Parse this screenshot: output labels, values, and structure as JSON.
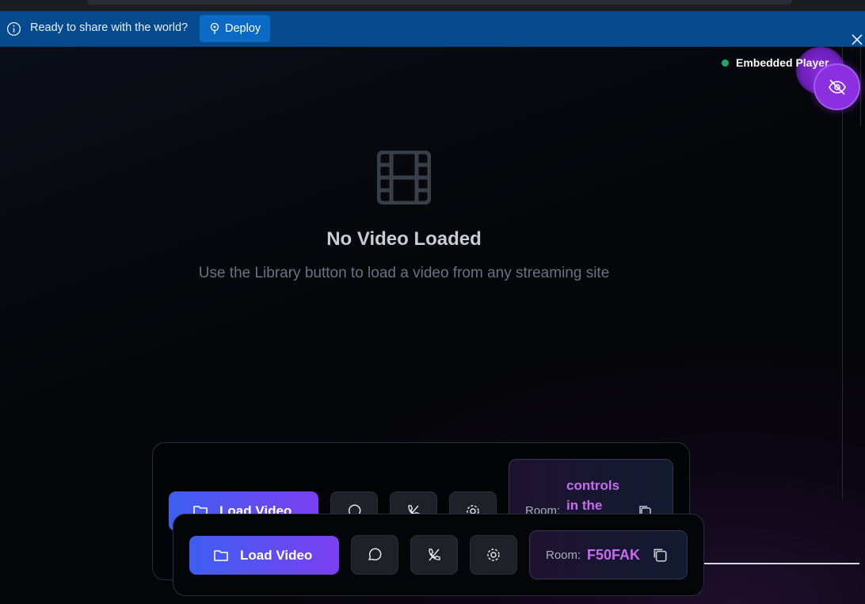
{
  "banner": {
    "message": "Ready to share with the world?",
    "deploy_label": "Deploy"
  },
  "status": {
    "label": "Embedded Player",
    "dot_color": "#1fa86b"
  },
  "empty_state": {
    "title": "No Video Loaded",
    "subtitle": "Use the Library button to load a video from any streaming site"
  },
  "back_panel": {
    "load_label": "Load Video",
    "room_label": "Room:",
    "tooltip_text": "controls in the"
  },
  "controls": {
    "load_label": "Load Video",
    "room_label": "Room:",
    "room_code": "F50FAK"
  },
  "colors": {
    "banner_bg": "#054a8d",
    "accent_purple": "#8b2fe0",
    "room_code": "#c56cf0"
  }
}
